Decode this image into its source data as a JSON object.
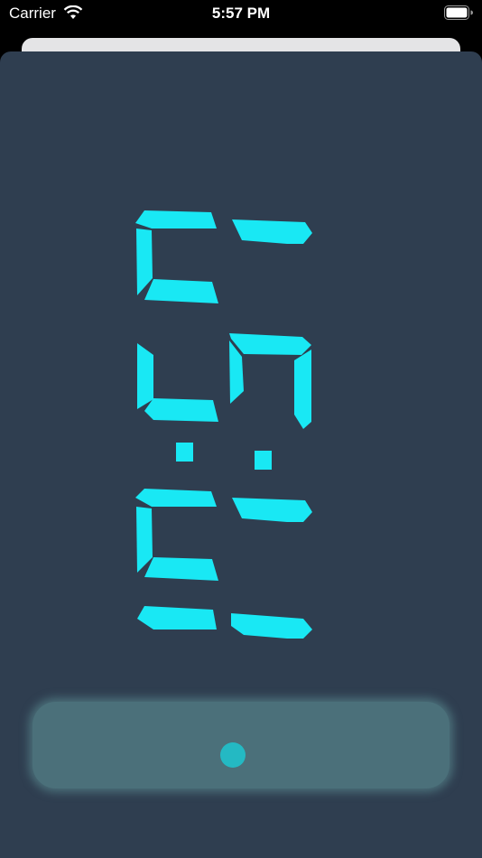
{
  "status_bar": {
    "carrier": "Carrier",
    "time": "5:57 PM",
    "wifi_icon": "wifi-icon",
    "battery_icon": "battery-icon"
  },
  "display": {
    "time_digits": [
      "5",
      "5",
      ":",
      "7"
    ],
    "orientation": "rotated-90",
    "digit_color": "#19e8f4",
    "background_color": "#2f3e50"
  },
  "control_panel": {
    "panel_color": "#4b707a",
    "knob_color": "#24b9c3",
    "knob_icon": "dot-icon"
  }
}
